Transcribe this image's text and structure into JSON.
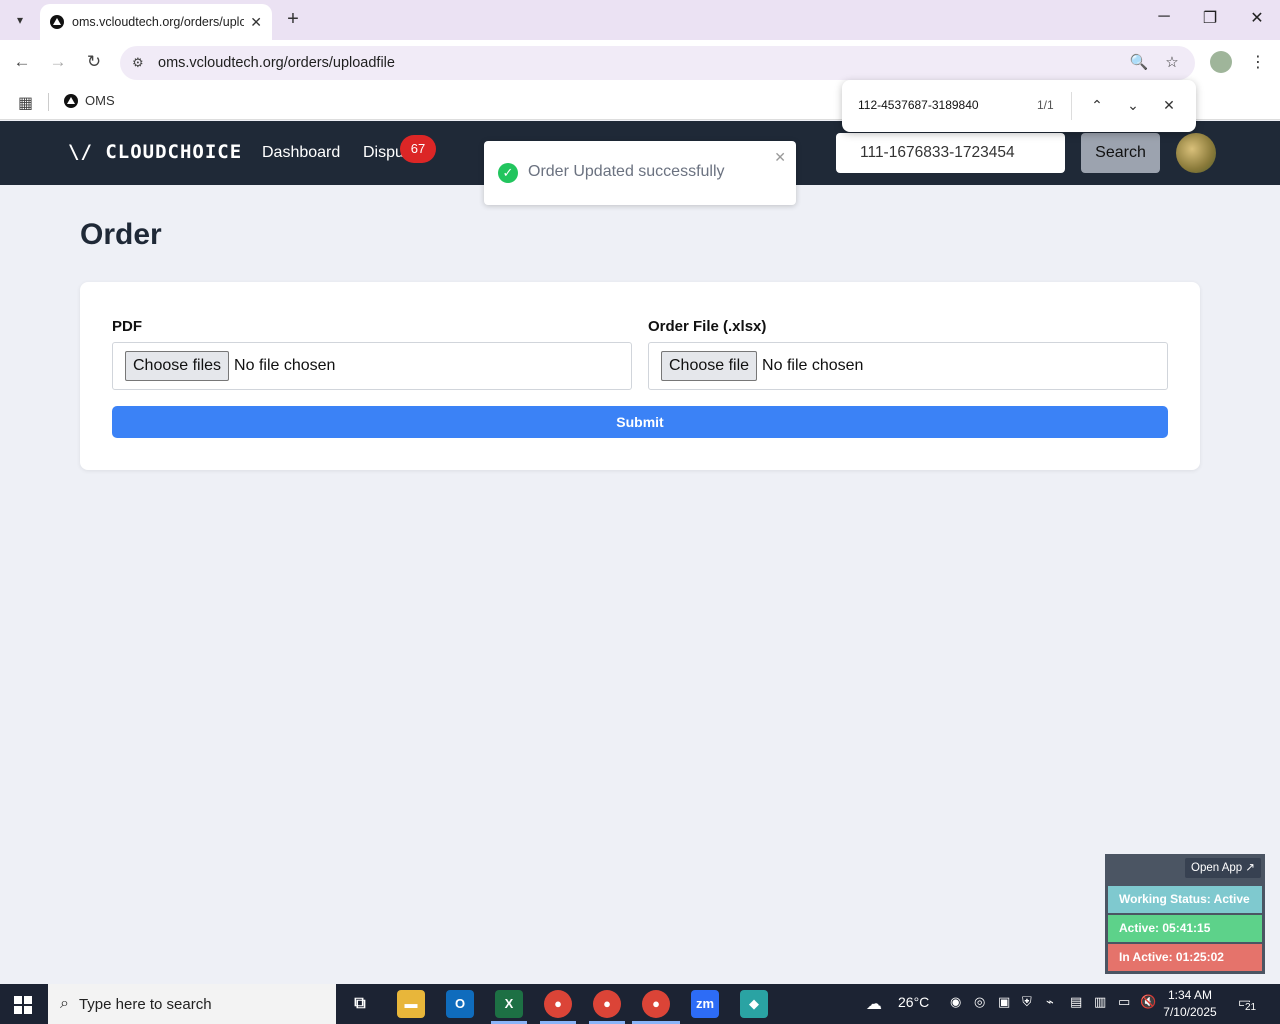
{
  "browser": {
    "tab_title": "oms.vcloudtech.org/orders/uplo",
    "url": "oms.vcloudtech.org/orders/uploadfile",
    "bookmark": "OMS"
  },
  "findbar": {
    "query": "112-4537687-3189840",
    "count": "1/1"
  },
  "app": {
    "logo": "\\/ CLOUDCHOICE",
    "nav": [
      "Dashboard",
      "Dispu"
    ],
    "badge": "67",
    "search_value": "111-1676833-1723454",
    "search_button": "Search"
  },
  "toast": {
    "message": "Order Updated successfully"
  },
  "page": {
    "title": "Order",
    "pdf_label": "PDF",
    "pdf_button": "Choose files",
    "pdf_status": "No file chosen",
    "order_label": "Order File (.xlsx)",
    "order_button": "Choose file",
    "order_status": "No file chosen",
    "submit": "Submit"
  },
  "tracker": {
    "open_app": "Open App ↗",
    "status": "Working Status: Active",
    "active": "Active: 05:41:15",
    "inactive": "In Active: 01:25:02",
    "colors": {
      "status": "#7fc9cf",
      "active": "#5dd28a",
      "inactive": "#e5736b"
    }
  },
  "taskbar": {
    "search_placeholder": "Type here to search",
    "weather": "26°C",
    "time": "1:34 AM",
    "date": "7/10/2025",
    "notifications": "21"
  }
}
